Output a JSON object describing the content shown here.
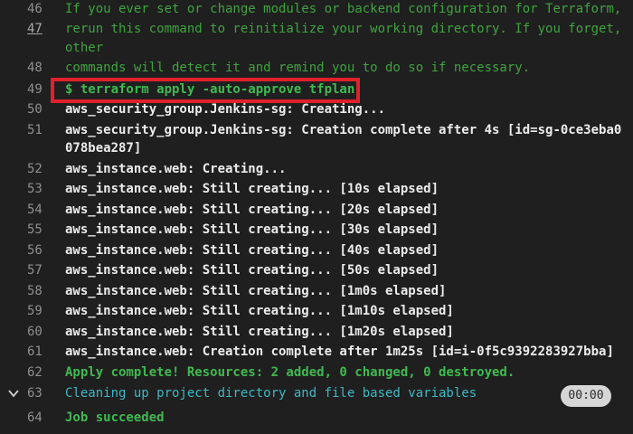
{
  "lines": [
    {
      "n": "46",
      "t": "If you ever set or change modules or backend configuration for Terraform,"
    },
    {
      "n": "47",
      "t": "rerun this command to reinitialize your working directory. If you forget,"
    },
    {
      "n": "",
      "t": "other"
    },
    {
      "n": "48",
      "t": "commands will detect it and remind you to do so if necessary."
    },
    {
      "n": "49",
      "t": "$ terraform apply -auto-approve tfplan"
    },
    {
      "n": "50",
      "t": "aws_security_group.Jenkins-sg: Creating..."
    },
    {
      "n": "51",
      "t": "aws_security_group.Jenkins-sg: Creation complete after 4s [id=sg-0ce3eba0"
    },
    {
      "n": "",
      "t": "078bea287]"
    },
    {
      "n": "52",
      "t": "aws_instance.web: Creating..."
    },
    {
      "n": "53",
      "t": "aws_instance.web: Still creating... [10s elapsed]"
    },
    {
      "n": "54",
      "t": "aws_instance.web: Still creating... [20s elapsed]"
    },
    {
      "n": "55",
      "t": "aws_instance.web: Still creating... [30s elapsed]"
    },
    {
      "n": "56",
      "t": "aws_instance.web: Still creating... [40s elapsed]"
    },
    {
      "n": "57",
      "t": "aws_instance.web: Still creating... [50s elapsed]"
    },
    {
      "n": "58",
      "t": "aws_instance.web: Still creating... [1m0s elapsed]"
    },
    {
      "n": "59",
      "t": "aws_instance.web: Still creating... [1m10s elapsed]"
    },
    {
      "n": "60",
      "t": "aws_instance.web: Still creating... [1m20s elapsed]"
    },
    {
      "n": "61",
      "t": "aws_instance.web: Creation complete after 1m25s [id=i-0f5c9392283927bba]"
    },
    {
      "n": "62",
      "t": "Apply complete! Resources: 2 added, 0 changed, 0 destroyed."
    },
    {
      "n": "63",
      "t": "Cleaning up project directory and file based variables"
    },
    {
      "n": "64",
      "t": "Job succeeded"
    }
  ],
  "section_timer": "00:00",
  "colors": {
    "background": "#1f1f1f",
    "terraform_hint": "#3fa33f",
    "success": "#3fba50",
    "section": "#3db8c5",
    "highlight_box": "#e0202b"
  },
  "icons": {
    "collapse": "chevron-down-icon"
  }
}
